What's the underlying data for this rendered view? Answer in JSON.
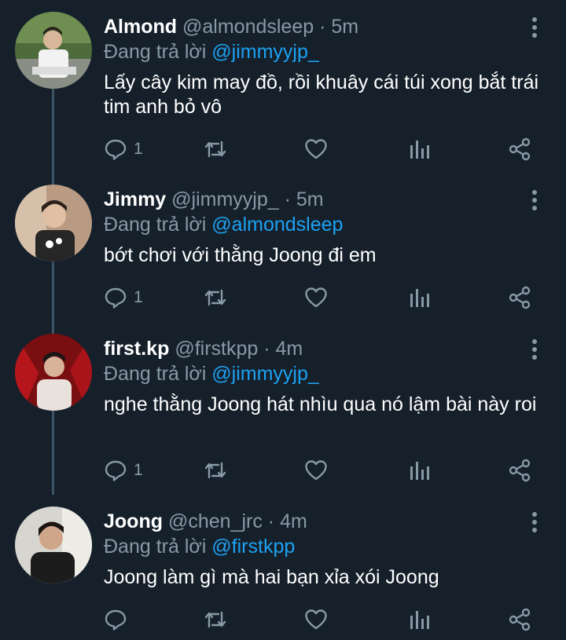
{
  "reply_prefix": "Đang trả lời",
  "colors": {
    "background": "#15202b",
    "secondary_text": "#8899a6",
    "mention": "#1da1f2",
    "thread_line": "#3d5466"
  },
  "tweets": [
    {
      "name": "Almond",
      "handle": "@almondsleep",
      "separator": "·",
      "time": "5m",
      "reply_to": "@jimmyyjp_",
      "text": "Lấy cây kim may đồ, rồi khuây cái túi xong bắt trái tim anh bỏ vô",
      "reply_count": "1"
    },
    {
      "name": "Jimmy",
      "handle": "@jimmyyjp_",
      "separator": "·",
      "time": "5m",
      "reply_to": "@almondsleep",
      "text": "bớt chơi với thằng Joong đi em",
      "reply_count": "1"
    },
    {
      "name": "first.kp",
      "handle": "@firstkpp",
      "separator": "·",
      "time": "4m",
      "reply_to": "@jimmyyjp_",
      "text": "nghe thằng Joong hát nhìu qua nó lậm bài này roi",
      "reply_count": "1"
    },
    {
      "name": "Joong",
      "handle": "@chen_jrc",
      "separator": "·",
      "time": "4m",
      "reply_to": "@firstkpp",
      "text": "Joong làm gì mà hai bạn xỉa xói Joong",
      "reply_count": ""
    }
  ],
  "icons": {
    "reply": "reply-bubble-icon",
    "retweet": "retweet-icon",
    "like": "heart-icon",
    "stats": "analytics-bars-icon",
    "share": "share-icon",
    "more": "more-vertical-icon"
  }
}
